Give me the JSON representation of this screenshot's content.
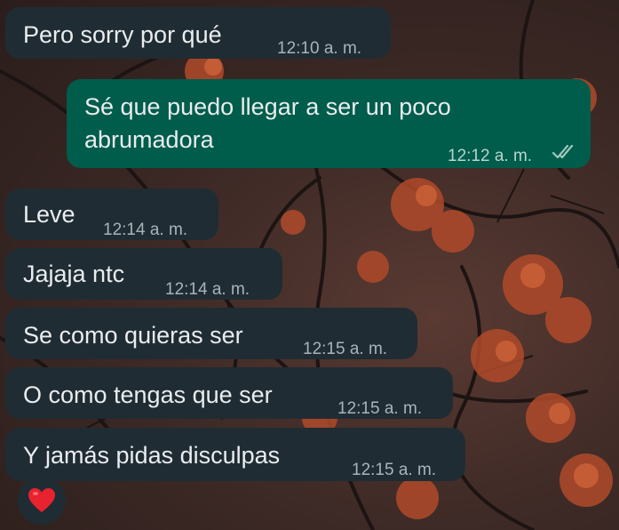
{
  "messages": [
    {
      "text": "Pero sorry por qué",
      "time": "12:10 a. m."
    },
    {
      "text_line1": "Sé que puedo llegar a ser un poco",
      "text_line2": "abrumadora",
      "time": "12:12 a. m.",
      "status_icon": "double-check-icon"
    },
    {
      "text": "Leve",
      "time": "12:14 a. m."
    },
    {
      "text": "Jajaja ntc",
      "time": "12:14 a. m."
    },
    {
      "text": "Se como quieras ser",
      "time": "12:15 a. m."
    },
    {
      "text": "O como tengas que ser",
      "time": "12:15 a. m."
    },
    {
      "text": "Y jamás pidas disculpas",
      "time": "12:15 a. m."
    }
  ],
  "reaction": {
    "icon": "red-heart-icon",
    "color": "#e8222e"
  },
  "colors": {
    "incoming_bubble": "#202c33",
    "outgoing_bubble": "#005c4b",
    "text": "#e9edef"
  }
}
